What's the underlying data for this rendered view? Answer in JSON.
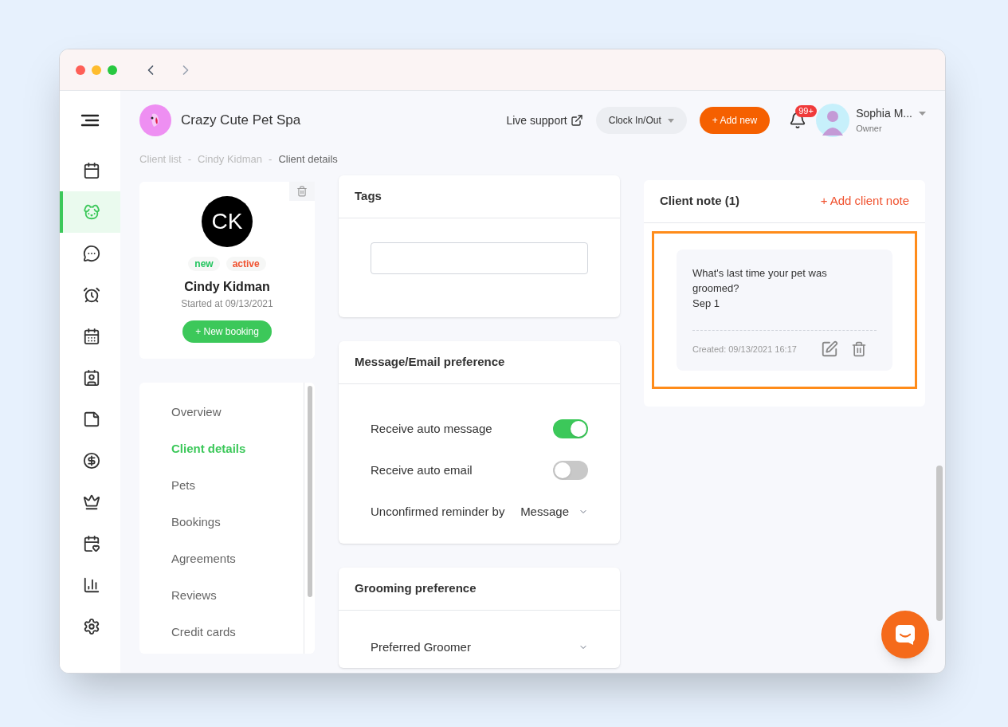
{
  "sidebar": {
    "items": [
      {
        "selected": false
      },
      {
        "selected": true
      },
      {
        "selected": false
      },
      {
        "selected": false
      },
      {
        "selected": false
      },
      {
        "selected": false
      },
      {
        "selected": false
      },
      {
        "selected": false
      },
      {
        "selected": false
      },
      {
        "selected": false
      },
      {
        "selected": false
      },
      {
        "selected": false
      }
    ]
  },
  "header": {
    "business": "Crazy Cute Pet Spa",
    "live_support": "Live support",
    "clock": "Clock In/Out",
    "add_new": "+ Add new",
    "notifications": "99+",
    "user": {
      "name": "Sophia M...",
      "role": "Owner"
    }
  },
  "breadcrumb": [
    {
      "label": "Client list",
      "selected": false
    },
    {
      "label": "Cindy Kidman",
      "selected": false
    },
    {
      "label": "Client details",
      "selected": true
    }
  ],
  "breadcrumb_separator": "-",
  "client": {
    "initials": "CK",
    "tags": [
      {
        "label": "new",
        "color": "#22c55e"
      },
      {
        "label": "active",
        "color": "#f0522f"
      }
    ],
    "name": "Cindy Kidman",
    "started": "Started at 09/13/2021",
    "new_booking": "+ New booking"
  },
  "client_nav": [
    {
      "label": "Overview",
      "selected": false
    },
    {
      "label": "Client details",
      "selected": true
    },
    {
      "label": "Pets",
      "selected": false
    },
    {
      "label": "Bookings",
      "selected": false
    },
    {
      "label": "Agreements",
      "selected": false
    },
    {
      "label": "Reviews",
      "selected": false
    },
    {
      "label": "Credit cards",
      "selected": false
    }
  ],
  "tags_card": {
    "title": "Tags"
  },
  "message_card": {
    "title": "Message/Email preference",
    "settings": [
      {
        "kind": "toggle",
        "label": "Receive auto message",
        "on": true
      },
      {
        "kind": "toggle",
        "label": "Receive auto email",
        "on": false
      },
      {
        "kind": "select",
        "label": "Unconfirmed reminder by",
        "value": "Message"
      }
    ]
  },
  "grooming_card": {
    "title": "Grooming preference",
    "settings": [
      {
        "kind": "select",
        "label": "Preferred Groomer"
      }
    ]
  },
  "notes": {
    "title": "Client note (1)",
    "add": "+ Add client note",
    "items": [
      {
        "lines": [
          "What's last time your pet was groomed?",
          "Sep 1"
        ],
        "created": "Created: 09/13/2021 16:17"
      }
    ]
  }
}
